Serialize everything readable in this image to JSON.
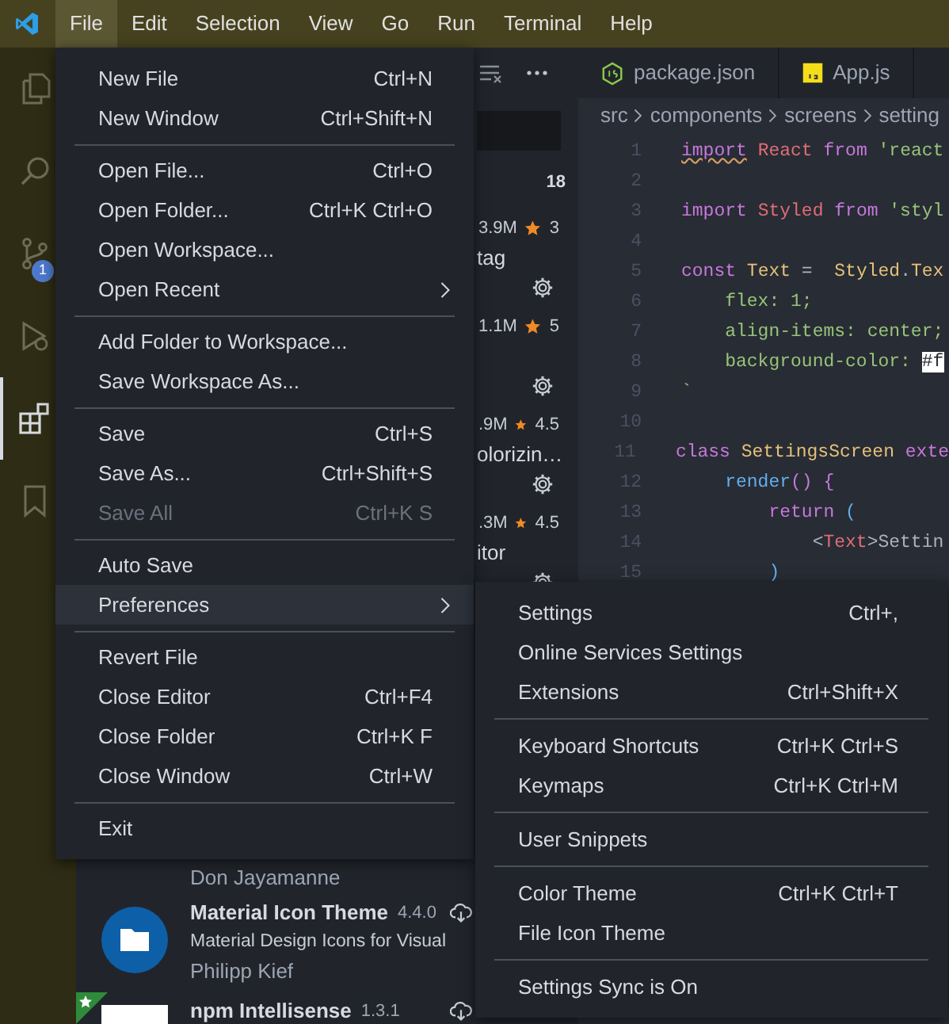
{
  "menu_bar": {
    "items": [
      {
        "label": "File",
        "selected": true
      },
      {
        "label": "Edit",
        "selected": false
      },
      {
        "label": "Selection",
        "selected": false
      },
      {
        "label": "View",
        "selected": false
      },
      {
        "label": "Go",
        "selected": false
      },
      {
        "label": "Run",
        "selected": false
      },
      {
        "label": "Terminal",
        "selected": false
      },
      {
        "label": "Help",
        "selected": false
      }
    ]
  },
  "activity_bar": {
    "items": [
      {
        "kind": "files",
        "selected": false
      },
      {
        "kind": "search",
        "selected": false
      },
      {
        "kind": "source-control",
        "selected": false,
        "badge": "1"
      },
      {
        "kind": "debug",
        "selected": false
      },
      {
        "kind": "extensions",
        "selected": true
      },
      {
        "kind": "bookmarks",
        "selected": false
      }
    ]
  },
  "sidebar": {
    "installed_count": "18",
    "extensions": [
      {
        "kind": "partial",
        "downloads": "3.9M",
        "rating": "3",
        "fragment": "tag",
        "gear": true
      },
      {
        "kind": "partial",
        "downloads": "1.1M",
        "rating": "5",
        "gear": true
      },
      {
        "kind": "partial",
        "downloads": ".9M",
        "rating": "4.5",
        "fragment": "olorizin…",
        "gear": true
      },
      {
        "kind": "partial",
        "downloads": ".3M",
        "rating": "4.5",
        "fragment": "itor",
        "gear": true
      },
      {
        "kind": "hidden"
      },
      {
        "kind": "hidden"
      },
      {
        "kind": "hidden",
        "publisher": "Don Jayamanne"
      },
      {
        "kind": "folder",
        "title": "Material Icon Theme",
        "version": "4.4.0",
        "description": "Material Design Icons for Visual",
        "publisher": "Philipp Kief"
      },
      {
        "kind": "plain",
        "title": "npm Intellisense",
        "version": "1.3.1",
        "starred": true
      }
    ]
  },
  "editor": {
    "tabs": [
      {
        "label": "package.json"
      },
      {
        "label": "App.js"
      }
    ],
    "breadcrumb": [
      "src",
      "components",
      "screens",
      "setting"
    ],
    "lines": [
      {
        "number": "1",
        "tokens": [
          {
            "text": "import",
            "kind": "keyword",
            "squiggle": true
          },
          {
            "text": " React",
            "kind": "variable"
          },
          {
            "text": " from",
            "kind": "keyword"
          },
          {
            "text": " 'react",
            "kind": "string"
          }
        ]
      },
      {
        "number": "2"
      },
      {
        "number": "3",
        "tokens": [
          {
            "text": "import",
            "kind": "keyword"
          },
          {
            "text": " Styled",
            "kind": "variable"
          },
          {
            "text": " from",
            "kind": "keyword"
          },
          {
            "text": " 'styl",
            "kind": "string"
          }
        ]
      },
      {
        "number": "4"
      },
      {
        "number": "5",
        "tokens": [
          {
            "text": "const",
            "kind": "keyword"
          },
          {
            "text": " Text",
            "kind": "type"
          },
          {
            "text": " =  ",
            "kind": "plain"
          },
          {
            "text": "Styled",
            "kind": "type"
          },
          {
            "text": ".",
            "kind": "plain"
          },
          {
            "text": "Tex",
            "kind": "type"
          }
        ]
      },
      {
        "number": "6",
        "tokens": [
          {
            "text": "    flex: 1;",
            "kind": "string"
          }
        ]
      },
      {
        "number": "7",
        "tokens": [
          {
            "text": "    align-items: center;",
            "kind": "string"
          }
        ]
      },
      {
        "number": "8",
        "tokens": [
          {
            "text": "    background-color: ",
            "kind": "string"
          },
          {
            "text": "#f",
            "kind": "swatch"
          }
        ]
      },
      {
        "number": "9",
        "tokens": [
          {
            "text": "`",
            "kind": "string"
          }
        ]
      },
      {
        "number": "10"
      },
      {
        "number": "11",
        "tokens": [
          {
            "text": "class",
            "kind": "keyword"
          },
          {
            "text": " SettingsScreen",
            "kind": "type"
          },
          {
            "text": " exte",
            "kind": "keyword"
          }
        ]
      },
      {
        "number": "12",
        "tokens": [
          {
            "text": "    render",
            "kind": "function"
          },
          {
            "text": "()",
            "kind": "keyword"
          },
          {
            "text": " {",
            "kind": "keyword"
          }
        ]
      },
      {
        "number": "13",
        "tokens": [
          {
            "text": "        return",
            "kind": "keyword"
          },
          {
            "text": " (",
            "kind": "function"
          }
        ]
      },
      {
        "number": "14",
        "tokens": [
          {
            "text": "            <",
            "kind": "plain"
          },
          {
            "text": "Text",
            "kind": "variable"
          },
          {
            "text": ">Settin",
            "kind": "plain"
          }
        ]
      },
      {
        "number": "15",
        "tokens": [
          {
            "text": "        )",
            "kind": "function"
          }
        ]
      }
    ]
  },
  "file_menu": {
    "items": [
      {
        "kind": "item",
        "label": "New File",
        "shortcut": "Ctrl+N",
        "selected": false,
        "disabled": false
      },
      {
        "kind": "item",
        "label": "New Window",
        "shortcut": "Ctrl+Shift+N",
        "selected": false,
        "disabled": false
      },
      {
        "kind": "separator"
      },
      {
        "kind": "item",
        "label": "Open File...",
        "shortcut": "Ctrl+O",
        "selected": false,
        "disabled": false
      },
      {
        "kind": "item",
        "label": "Open Folder...",
        "shortcut": "Ctrl+K Ctrl+O",
        "selected": false,
        "disabled": false
      },
      {
        "kind": "item",
        "label": "Open Workspace...",
        "selected": false,
        "disabled": false
      },
      {
        "kind": "item",
        "label": "Open Recent",
        "submenu": true,
        "selected": false,
        "disabled": false
      },
      {
        "kind": "separator"
      },
      {
        "kind": "item",
        "label": "Add Folder to Workspace...",
        "selected": false,
        "disabled": false
      },
      {
        "kind": "item",
        "label": "Save Workspace As...",
        "selected": false,
        "disabled": false
      },
      {
        "kind": "separator"
      },
      {
        "kind": "item",
        "label": "Save",
        "shortcut": "Ctrl+S",
        "selected": false,
        "disabled": false
      },
      {
        "kind": "item",
        "label": "Save As...",
        "shortcut": "Ctrl+Shift+S",
        "selected": false,
        "disabled": false
      },
      {
        "kind": "item",
        "label": "Save All",
        "shortcut": "Ctrl+K S",
        "selected": false,
        "disabled": true
      },
      {
        "kind": "separator"
      },
      {
        "kind": "item",
        "label": "Auto Save",
        "selected": false,
        "disabled": false
      },
      {
        "kind": "item",
        "label": "Preferences",
        "submenu": true,
        "selected": true,
        "disabled": false
      },
      {
        "kind": "separator"
      },
      {
        "kind": "item",
        "label": "Revert File",
        "selected": false,
        "disabled": false
      },
      {
        "kind": "item",
        "label": "Close Editor",
        "shortcut": "Ctrl+F4",
        "selected": false,
        "disabled": false
      },
      {
        "kind": "item",
        "label": "Close Folder",
        "shortcut": "Ctrl+K F",
        "selected": false,
        "disabled": false
      },
      {
        "kind": "item",
        "label": "Close Window",
        "shortcut": "Ctrl+W",
        "selected": false,
        "disabled": false
      },
      {
        "kind": "separator"
      },
      {
        "kind": "item",
        "label": "Exit",
        "selected": false,
        "disabled": false
      }
    ]
  },
  "preferences_menu": {
    "items": [
      {
        "kind": "item",
        "label": "Settings",
        "shortcut": "Ctrl+,",
        "selected": false,
        "disabled": false
      },
      {
        "kind": "item",
        "label": "Online Services Settings",
        "selected": false,
        "disabled": false
      },
      {
        "kind": "item",
        "label": "Extensions",
        "shortcut": "Ctrl+Shift+X",
        "selected": false,
        "disabled": false
      },
      {
        "kind": "separator"
      },
      {
        "kind": "item",
        "label": "Keyboard Shortcuts",
        "shortcut": "Ctrl+K Ctrl+S",
        "selected": false,
        "disabled": false
      },
      {
        "kind": "item",
        "label": "Keymaps",
        "shortcut": "Ctrl+K Ctrl+M",
        "selected": false,
        "disabled": false
      },
      {
        "kind": "separator"
      },
      {
        "kind": "item",
        "label": "User Snippets",
        "selected": false,
        "disabled": false
      },
      {
        "kind": "separator"
      },
      {
        "kind": "item",
        "label": "Color Theme",
        "shortcut": "Ctrl+K Ctrl+T",
        "selected": false,
        "disabled": false
      },
      {
        "kind": "item",
        "label": "File Icon Theme",
        "selected": false,
        "disabled": false
      },
      {
        "kind": "separator"
      },
      {
        "kind": "item",
        "label": "Settings Sync is On",
        "selected": false,
        "disabled": false
      }
    ]
  }
}
